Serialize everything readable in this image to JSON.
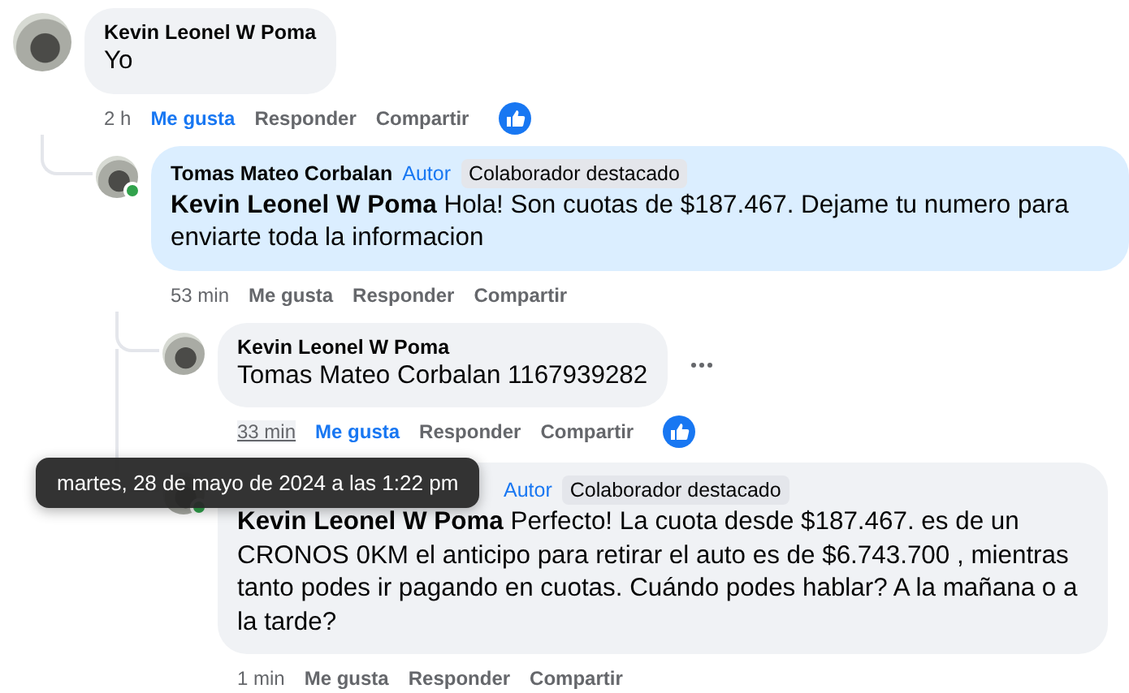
{
  "comments": [
    {
      "author": "Kevin Leonel W Poma",
      "text": "Yo",
      "highlighted": false,
      "online": false,
      "time": "2 h",
      "time_hovered": false,
      "liked": true,
      "like_label": "Me gusta",
      "reply_label": "Responder",
      "share_label": "Compartir",
      "reaction": true,
      "menu": false,
      "children": [
        {
          "author": "Tomas Mateo Corbalan",
          "badges": [
            {
              "label": "Autor",
              "kind": "author"
            },
            {
              "label": "Colaborador destacado",
              "kind": "top"
            }
          ],
          "text": "**Kevin Leonel W Poma** Hola! Son cuotas de $187.467. Dejame tu numero para enviarte toda la informacion",
          "highlighted": true,
          "online": true,
          "time": "53 min",
          "time_hovered": false,
          "liked": false,
          "like_label": "Me gusta",
          "reply_label": "Responder",
          "share_label": "Compartir",
          "reaction": false,
          "menu": false,
          "children": [
            {
              "author": "Kevin Leonel W Poma",
              "text": "Tomas Mateo Corbalan 1167939282",
              "highlighted": false,
              "online": false,
              "time": "33 min",
              "time_hovered": true,
              "liked": true,
              "like_label": "Me gusta",
              "reply_label": "Responder",
              "share_label": "Compartir",
              "reaction": true,
              "menu": true
            },
            {
              "badges": [
                {
                  "label": "Autor",
                  "kind": "author"
                },
                {
                  "label": "Colaborador destacado",
                  "kind": "top"
                }
              ],
              "text": "**Kevin Leonel W Poma** Perfecto! La cuota desde $187.467. es de un CRONOS 0KM el anticipo para retirar el auto es de $6.743.700 , mientras tanto podes ir pagando en cuotas. Cuándo podes hablar? A la mañana o a la tarde?",
              "highlighted": false,
              "online": true,
              "time": "1 min",
              "time_hovered": false,
              "liked": false,
              "like_label": "Me gusta",
              "reply_label": "Responder",
              "share_label": "Compartir",
              "reaction": false,
              "menu": false
            }
          ]
        }
      ]
    }
  ],
  "tooltip": "martes, 28 de mayo de 2024 a las 1:22 pm"
}
